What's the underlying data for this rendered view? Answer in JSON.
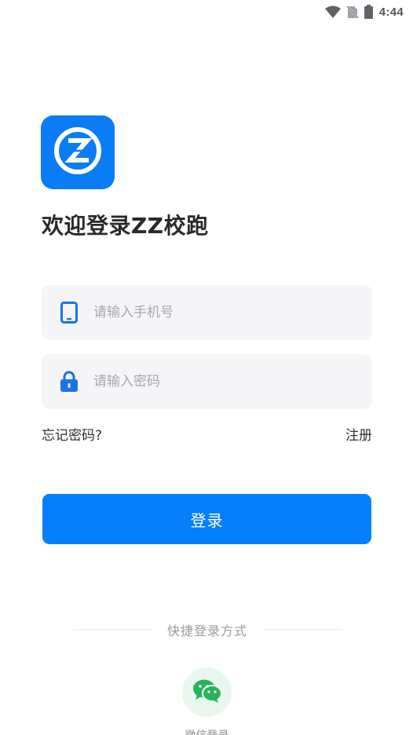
{
  "status_bar": {
    "time": "4:44",
    "icons": [
      "wifi-icon",
      "no-sim-icon",
      "battery-icon"
    ]
  },
  "app": {
    "logo_icon": "zz-logo-icon",
    "brand_color": "#0a7cf5"
  },
  "header": {
    "title": "欢迎登录ZZ校跑"
  },
  "form": {
    "phone": {
      "icon": "tablet-icon",
      "placeholder": "请输入手机号",
      "value": ""
    },
    "password": {
      "icon": "lock-icon",
      "placeholder": "请输入密码",
      "value": ""
    },
    "forgot_password_label": "忘记密码?",
    "register_label": "注册",
    "login_button_label": "登录",
    "login_button_color": "#067ffa"
  },
  "quick_login": {
    "title": "快捷登录方式",
    "wechat_icon": "wechat-icon",
    "wechat_label": "微信登录"
  }
}
